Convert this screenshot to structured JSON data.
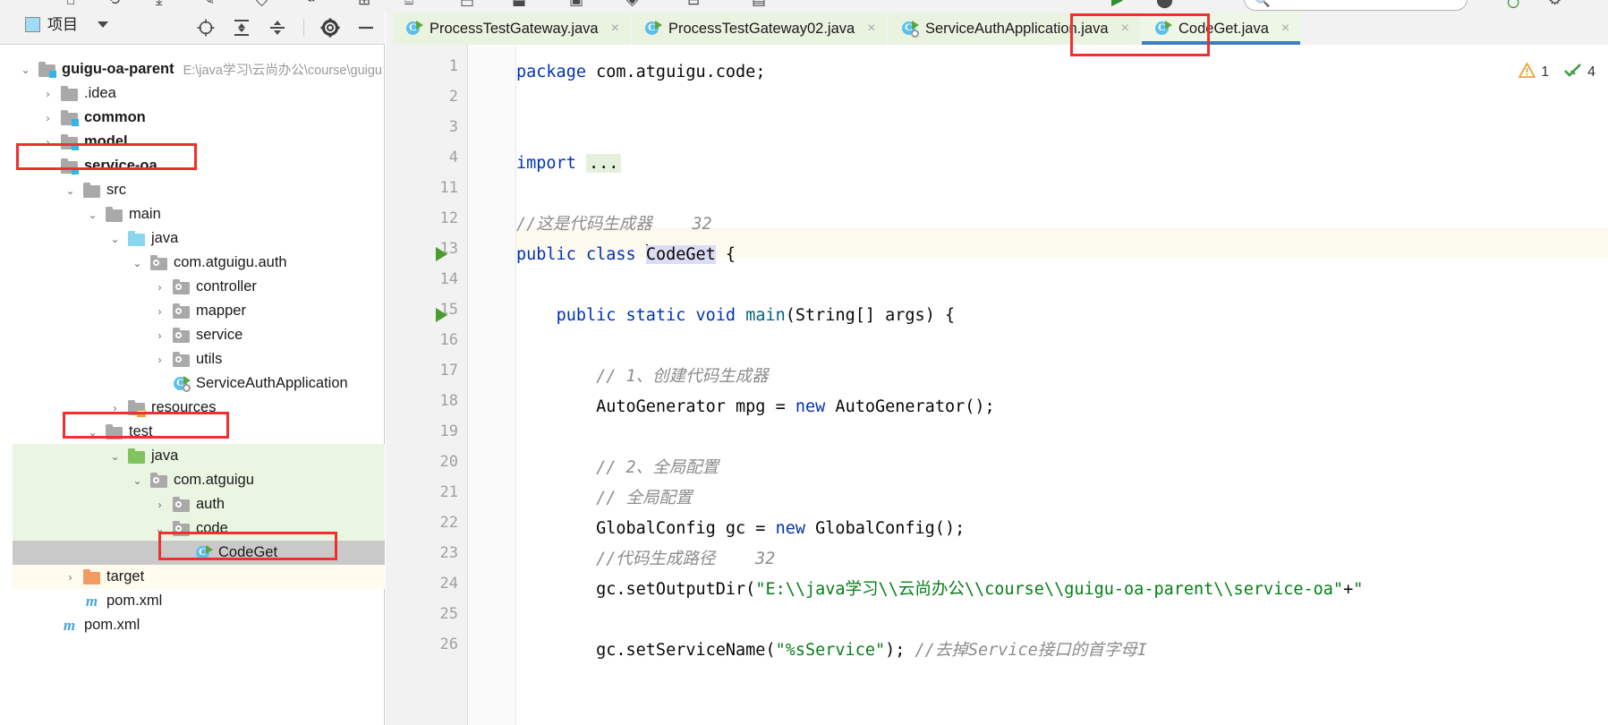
{
  "window": {
    "search_placeholder": ""
  },
  "project_panel": {
    "title": "项目",
    "caret_icon": "chevron-down-icon",
    "tools": [
      {
        "name": "locate-icon",
        "tip": "Select Opened File"
      },
      {
        "name": "expand-all-icon",
        "tip": "Expand All"
      },
      {
        "name": "collapse-all-icon",
        "tip": "Collapse All"
      },
      {
        "name": "settings-gear-icon",
        "tip": "Settings"
      },
      {
        "name": "hide-icon",
        "tip": "Hide"
      }
    ],
    "side_strip_label": "项目",
    "tree": [
      {
        "indent": 0,
        "arrow": "v",
        "icon": "module-folder",
        "label": "guigu-oa-parent",
        "bold": true,
        "note": "E:\\java学习\\云尚办公\\course\\guigu",
        "bg": "none"
      },
      {
        "indent": 1,
        "arrow": ">",
        "icon": "folder",
        "label": ".idea",
        "bold": false,
        "note": "",
        "bg": "none"
      },
      {
        "indent": 1,
        "arrow": ">",
        "icon": "module-folder",
        "label": "common",
        "bold": true,
        "note": "",
        "bg": "none"
      },
      {
        "indent": 1,
        "arrow": ">",
        "icon": "module-folder",
        "label": "model",
        "bold": true,
        "note": "",
        "bg": "none"
      },
      {
        "indent": 1,
        "arrow": "v",
        "icon": "module-folder",
        "label": "service-oa",
        "bold": true,
        "note": "",
        "bg": "none"
      },
      {
        "indent": 2,
        "arrow": "v",
        "icon": "folder",
        "label": "src",
        "bold": false,
        "note": "",
        "bg": "none"
      },
      {
        "indent": 3,
        "arrow": "v",
        "icon": "folder",
        "label": "main",
        "bold": false,
        "note": "",
        "bg": "none"
      },
      {
        "indent": 4,
        "arrow": "v",
        "icon": "source-folder-blue",
        "label": "java",
        "bold": false,
        "note": "",
        "bg": "none"
      },
      {
        "indent": 5,
        "arrow": "v",
        "icon": "package-folder",
        "label": "com.atguigu.auth",
        "bold": false,
        "note": "",
        "bg": "none"
      },
      {
        "indent": 6,
        "arrow": ">",
        "icon": "package-folder",
        "label": "controller",
        "bold": false,
        "note": "",
        "bg": "none"
      },
      {
        "indent": 6,
        "arrow": ">",
        "icon": "package-folder",
        "label": "mapper",
        "bold": false,
        "note": "",
        "bg": "none"
      },
      {
        "indent": 6,
        "arrow": ">",
        "icon": "package-folder",
        "label": "service",
        "bold": false,
        "note": "",
        "bg": "none"
      },
      {
        "indent": 6,
        "arrow": ">",
        "icon": "package-folder",
        "label": "utils",
        "bold": false,
        "note": "",
        "bg": "none"
      },
      {
        "indent": 6,
        "arrow": "",
        "icon": "java-class-run-config",
        "label": "ServiceAuthApplication",
        "bold": false,
        "note": "",
        "bg": "none"
      },
      {
        "indent": 4,
        "arrow": ">",
        "icon": "resources-folder",
        "label": "resources",
        "bold": false,
        "note": "",
        "bg": "none"
      },
      {
        "indent": 3,
        "arrow": "v",
        "icon": "folder",
        "label": "test",
        "bold": false,
        "note": "",
        "bg": "none"
      },
      {
        "indent": 4,
        "arrow": "v",
        "icon": "test-source-folder-green",
        "label": "java",
        "bold": false,
        "note": "",
        "bg": "green"
      },
      {
        "indent": 5,
        "arrow": "v",
        "icon": "package-folder",
        "label": "com.atguigu",
        "bold": false,
        "note": "",
        "bg": "green"
      },
      {
        "indent": 6,
        "arrow": ">",
        "icon": "package-folder",
        "label": "auth",
        "bold": false,
        "note": "",
        "bg": "green"
      },
      {
        "indent": 6,
        "arrow": "v",
        "icon": "package-folder",
        "label": "code",
        "bold": false,
        "note": "",
        "bg": "green"
      },
      {
        "indent": 7,
        "arrow": "",
        "icon": "java-class-run",
        "label": "CodeGet",
        "bold": false,
        "note": "",
        "bg": "selected"
      },
      {
        "indent": 2,
        "arrow": ">",
        "icon": "target-folder-orange",
        "label": "target",
        "bold": false,
        "note": "",
        "bg": "yellow"
      },
      {
        "indent": 2,
        "arrow": "",
        "icon": "maven-m",
        "label": "pom.xml",
        "bold": false,
        "note": "",
        "bg": "none"
      },
      {
        "indent": 1,
        "arrow": "",
        "icon": "maven-m",
        "label": "pom.xml",
        "bold": false,
        "note": "",
        "bg": "none"
      }
    ],
    "highlights": [
      {
        "name": "service-oa-highlight"
      },
      {
        "name": "test-highlight"
      },
      {
        "name": "codeget-node-highlight"
      }
    ]
  },
  "editor": {
    "tabs": [
      {
        "label": "ProcessTestGateway.java",
        "icon": "java-class-run-icon",
        "active": false,
        "close": "×"
      },
      {
        "label": "ProcessTestGateway02.java",
        "icon": "java-class-run-icon",
        "active": false,
        "close": "×"
      },
      {
        "label": "ServiceAuthApplication.java",
        "icon": "java-class-spring-icon",
        "active": false,
        "close": "×"
      },
      {
        "label": "CodeGet.java",
        "icon": "java-class-run-icon",
        "active": true,
        "close": "×"
      }
    ],
    "active_tab_highlight": "codeget-tab-highlight",
    "inspection": {
      "warning_icon": "warning-triangle-icon",
      "warning_count": "1",
      "ok_icon": "inspection-ok-icon",
      "ok_count": "4"
    },
    "gutter_line_numbers": [
      "1",
      "2",
      "3",
      "4",
      "11",
      "12",
      "13",
      "14",
      "15",
      "16",
      "17",
      "18",
      "19",
      "20",
      "21",
      "22",
      "23",
      "24",
      "25",
      "26"
    ],
    "lines": [
      {
        "num": "1",
        "html": "<span class='kw'>package</span> com.atguigu.code;"
      },
      {
        "num": "2",
        "html": ""
      },
      {
        "num": "3",
        "html": ""
      },
      {
        "num": "4",
        "html": "<span class='kw'>import</span> <span class='import-dots'>...</span>"
      },
      {
        "num": "11",
        "html": ""
      },
      {
        "num": "12",
        "html": "<span class='cmt'>//这是代码生成器</span>    <span class='cmt'>32</span>"
      },
      {
        "num": "13",
        "html": "<span class='kw'>public</span> <span class='kw'>class</span> <span class='caret-bar'></span><span class='caret-sel'>CodeGet</span> {"
      },
      {
        "num": "14",
        "html": ""
      },
      {
        "num": "15",
        "html": "    <span class='kw'>public</span> <span class='kw'>static</span> <span class='kw'>void</span> <span class='meth'>main</span>(String[] args) {"
      },
      {
        "num": "16",
        "html": ""
      },
      {
        "num": "17",
        "html": "        <span class='cmt'>// 1、创建代码生成器</span>"
      },
      {
        "num": "18",
        "html": "        AutoGenerator mpg = <span class='kw'>new</span> AutoGenerator();"
      },
      {
        "num": "19",
        "html": ""
      },
      {
        "num": "20",
        "html": "        <span class='cmt'>// 2、全局配置</span>"
      },
      {
        "num": "21",
        "html": "        <span class='cmt'>// 全局配置</span>"
      },
      {
        "num": "22",
        "html": "        GlobalConfig gc = <span class='kw'>new</span> GlobalConfig();"
      },
      {
        "num": "23",
        "html": "        <span class='cmt'>//代码生成路径</span>    <span class='cmt'>32</span>"
      },
      {
        "num": "24",
        "html": "        gc.setOutputDir(<span class='str'>\"E:\\\\java学习\\\\云尚办公\\\\course\\\\guigu-oa-parent\\\\service-oa\"</span>+<span class='str'>\"</span>"
      },
      {
        "num": "25",
        "html": ""
      },
      {
        "num": "26",
        "html": "        gc.setServiceName(<span class='str'>\"%sService\"</span>); <span class='cmt'>//去掉Service接口的首字母I</span>"
      }
    ],
    "plain_lines": [
      "package com.atguigu.code;",
      "",
      "",
      "import ...",
      "",
      "//这是代码生成器    32",
      "public class CodeGet {",
      "",
      "    public static void main(String[] args) {",
      "",
      "        // 1、创建代码生成器",
      "        AutoGenerator mpg = new AutoGenerator();",
      "",
      "        // 2、全局配置",
      "        // 全局配置",
      "        GlobalConfig gc = new GlobalConfig();",
      "        //代码生成路径    32",
      "        gc.setOutputDir(\"E:\\\\java学习\\\\云尚办公\\\\course\\\\guigu-oa-parent\\\\service-oa\"+\"",
      "",
      "        gc.setServiceName(\"%sService\"); //去掉Service接口的首字母I"
    ],
    "run_markers": [
      "13",
      "15"
    ],
    "fold_markers": [
      "4",
      "15",
      "20",
      "21"
    ]
  },
  "colors": {
    "accent_blue": "#3c7fc1",
    "highlight_red": "#f03030",
    "keyword": "#0033b3",
    "string": "#067d17",
    "comment": "#8c8c8c",
    "method": "#00627a",
    "tab_active_bg": "#eef6e6",
    "test_source_bg": "#eaf5e2",
    "selection_bg": "#c9c9c9",
    "target_bg": "#fffced"
  }
}
